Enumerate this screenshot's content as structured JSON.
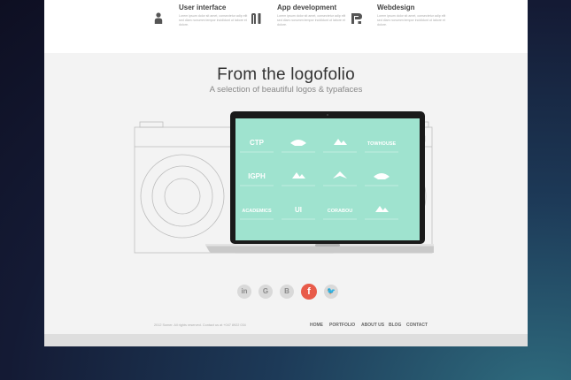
{
  "features": [
    {
      "title": "User interface",
      "desc": "Lorem ipsum dolor sit amet, consectetur adip elit sed diam nonumm tempor incididunt ut labore et dolore.",
      "icon": "person-icon"
    },
    {
      "title": "App development",
      "desc": "Lorem ipsum dolor sit amet, consectetur adip elit sed diam nonumm tempor incididunt ut labore et dolore.",
      "icon": "nl-icon"
    },
    {
      "title": "Webdesign",
      "desc": "Lorem ipsum dolor sit amet, consectetur adip elit sed diam nonumm tempor incididunt ut labore et dolore.",
      "icon": "r-icon"
    }
  ],
  "hero": {
    "title": "From the logofolio",
    "subtitle": "A selection of beautiful logos & typafaces"
  },
  "logos": [
    "CTP",
    "",
    "",
    "TOWHOUSE",
    "IGPH",
    "",
    "",
    "",
    "ACADEMICS",
    "UI",
    "CORABOU",
    ""
  ],
  "social": [
    "linkedin-icon",
    "google-icon",
    "blogger-icon",
    "facebook-icon",
    "twitter-icon"
  ],
  "social_glyphs": [
    "in",
    "G",
    "B",
    "f",
    "🐦"
  ],
  "footer": {
    "copyright": "2012 Somer. All rights reserved. Contact us at +047 8922 034",
    "nav": [
      "HOME",
      "PORTFOLIO",
      "ABOUT US",
      "BLOG",
      "CONTACT"
    ]
  },
  "colors": {
    "screen": "#9fe3cf",
    "facebook": "#e85b4a",
    "background": "#141a34"
  }
}
